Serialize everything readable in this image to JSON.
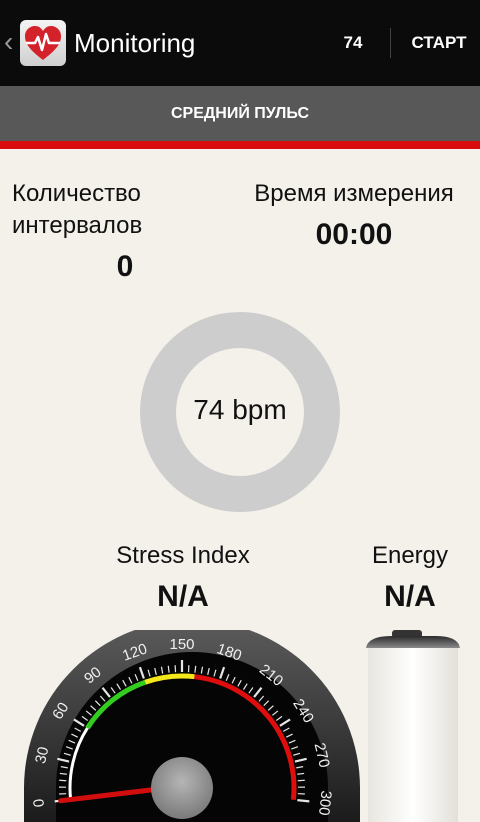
{
  "app": {
    "title": "Monitoring",
    "pulse_count": "74",
    "start_label": "СТАРТ",
    "back_glyph": "‹"
  },
  "tab": {
    "label": "СРЕДНИЙ ПУЛЬС"
  },
  "intervals": {
    "label_line1": "Количество",
    "label_line2": "интервалов",
    "value": "0"
  },
  "duration": {
    "label": "Время измерения",
    "value": "00:00"
  },
  "pulse": {
    "value": "74 bpm"
  },
  "stress": {
    "label": "Stress Index",
    "value": "N/A",
    "gauge_ticks": [
      "0",
      "30",
      "60",
      "90",
      "120",
      "150",
      "180",
      "210",
      "240",
      "270",
      "300"
    ],
    "needle_value": 0
  },
  "energy": {
    "label": "Energy",
    "value": "N/A"
  },
  "colors": {
    "accent": "#d80c0c",
    "actionbar": "#0b0b0b",
    "tab": "#585858",
    "ring": "#cdcdcd",
    "gauge_green": "#32cd1e",
    "gauge_yellow": "#f4e81b",
    "gauge_red": "#e00d0d"
  },
  "icons": {
    "app": "heart-pulse-icon",
    "back": "chevron-left-icon"
  }
}
